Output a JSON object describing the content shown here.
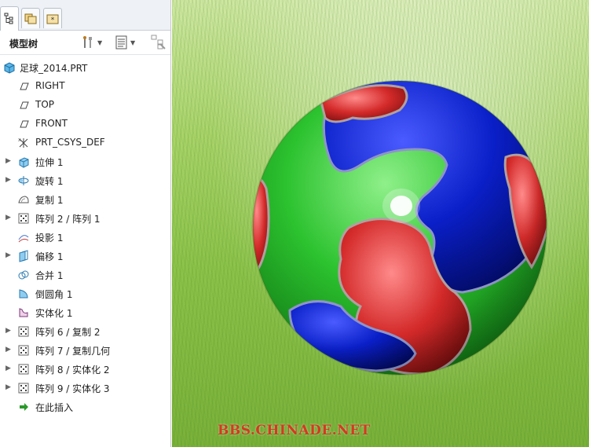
{
  "panel": {
    "title": "模型树",
    "icons": {
      "tab_model_tree": "model-tree-icon",
      "tab_folder": "folder-browser-icon",
      "tab_favorites": "favorites-icon",
      "settings": "settings-tools-icon",
      "show": "show-options-icon",
      "filter": "filter-icon"
    }
  },
  "tree": {
    "root": {
      "label": "足球_2014.PRT",
      "icon": "part-icon"
    },
    "items": [
      {
        "label": "RIGHT",
        "icon": "datum-plane-icon",
        "expandable": false
      },
      {
        "label": "TOP",
        "icon": "datum-plane-icon",
        "expandable": false
      },
      {
        "label": "FRONT",
        "icon": "datum-plane-icon",
        "expandable": false
      },
      {
        "label": "PRT_CSYS_DEF",
        "icon": "coordinate-system-icon",
        "expandable": false
      },
      {
        "label": "拉伸 1",
        "icon": "extrude-icon",
        "expandable": true
      },
      {
        "label": "旋转 1",
        "icon": "revolve-icon",
        "expandable": true
      },
      {
        "label": "复制 1",
        "icon": "copy-surface-icon",
        "expandable": false
      },
      {
        "label": "阵列 2 / 阵列 1",
        "icon": "pattern-icon",
        "expandable": true
      },
      {
        "label": "投影 1",
        "icon": "project-curve-icon",
        "expandable": false
      },
      {
        "label": "偏移 1",
        "icon": "offset-icon",
        "expandable": true
      },
      {
        "label": "合并 1",
        "icon": "merge-icon",
        "expandable": false
      },
      {
        "label": "倒圆角 1",
        "icon": "round-icon",
        "expandable": false
      },
      {
        "label": "实体化 1",
        "icon": "solidify-icon",
        "expandable": false
      },
      {
        "label": "阵列 6 / 复制 2",
        "icon": "pattern-icon",
        "expandable": true
      },
      {
        "label": "阵列 7 / 复制几何",
        "icon": "pattern-icon",
        "expandable": true
      },
      {
        "label": "阵列 8 / 实体化 2",
        "icon": "pattern-icon",
        "expandable": true
      },
      {
        "label": "阵列 9 / 实体化 3",
        "icon": "pattern-icon",
        "expandable": true
      },
      {
        "label": "在此插入",
        "icon": "insert-here-arrow-icon",
        "expandable": false
      }
    ]
  },
  "viewport": {
    "watermark": "BBS.CHINADE.NET",
    "colors": {
      "red": "#d42a2a",
      "green": "#22b22a",
      "blue": "#0a1fc8"
    }
  }
}
